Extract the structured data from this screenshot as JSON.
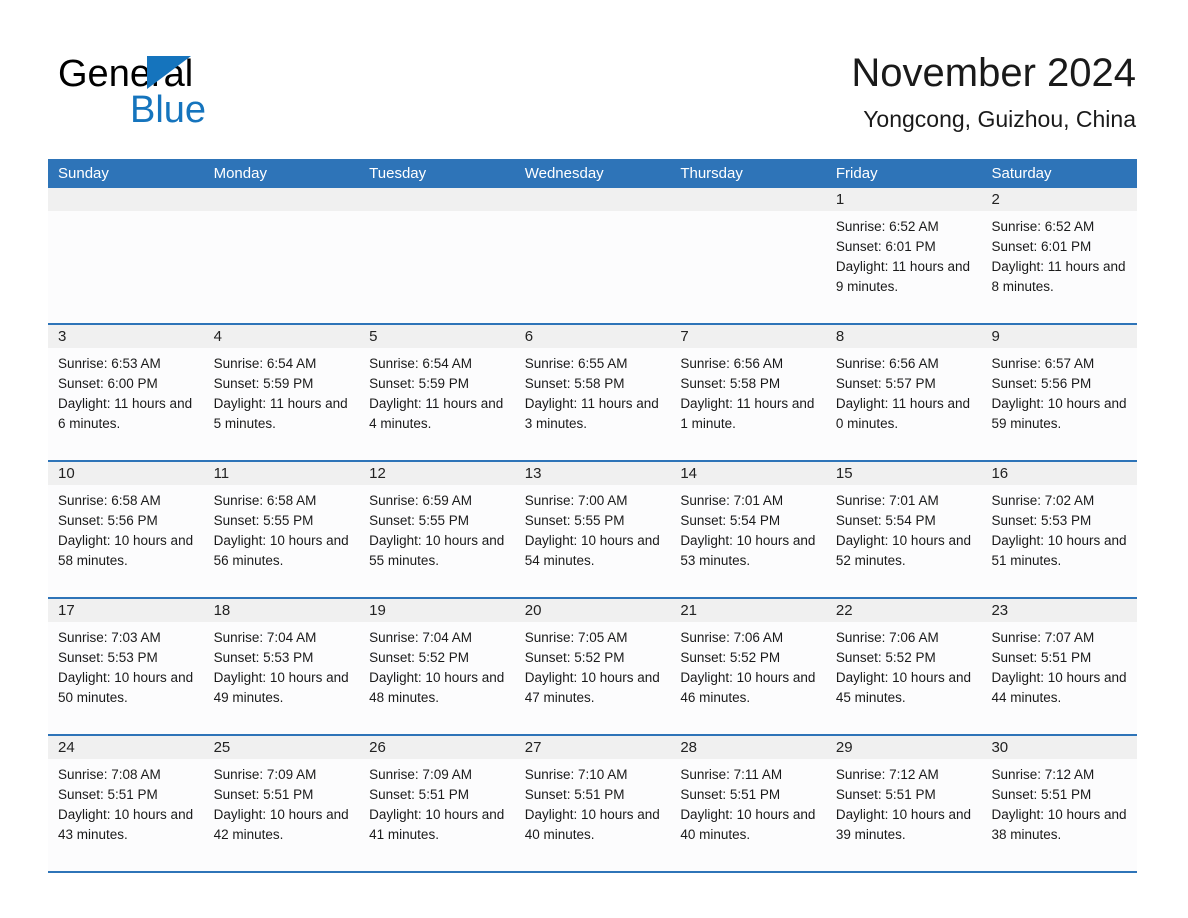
{
  "brand": {
    "name_part1": "General",
    "name_part2": "Blue",
    "accent_color": "#1574bd"
  },
  "header": {
    "title": "November 2024",
    "subtitle": "Yongcong, Guizhou, China"
  },
  "calendar": {
    "header_color": "#2e74b8",
    "daynum_band_color": "#f0f0f0",
    "weekdays": [
      "Sunday",
      "Monday",
      "Tuesday",
      "Wednesday",
      "Thursday",
      "Friday",
      "Saturday"
    ],
    "weeks": [
      [
        {
          "day": "",
          "sunrise": "",
          "sunset": "",
          "daylight": ""
        },
        {
          "day": "",
          "sunrise": "",
          "sunset": "",
          "daylight": ""
        },
        {
          "day": "",
          "sunrise": "",
          "sunset": "",
          "daylight": ""
        },
        {
          "day": "",
          "sunrise": "",
          "sunset": "",
          "daylight": ""
        },
        {
          "day": "",
          "sunrise": "",
          "sunset": "",
          "daylight": ""
        },
        {
          "day": "1",
          "sunrise": "Sunrise: 6:52 AM",
          "sunset": "Sunset: 6:01 PM",
          "daylight": "Daylight: 11 hours and 9 minutes."
        },
        {
          "day": "2",
          "sunrise": "Sunrise: 6:52 AM",
          "sunset": "Sunset: 6:01 PM",
          "daylight": "Daylight: 11 hours and 8 minutes."
        }
      ],
      [
        {
          "day": "3",
          "sunrise": "Sunrise: 6:53 AM",
          "sunset": "Sunset: 6:00 PM",
          "daylight": "Daylight: 11 hours and 6 minutes."
        },
        {
          "day": "4",
          "sunrise": "Sunrise: 6:54 AM",
          "sunset": "Sunset: 5:59 PM",
          "daylight": "Daylight: 11 hours and 5 minutes."
        },
        {
          "day": "5",
          "sunrise": "Sunrise: 6:54 AM",
          "sunset": "Sunset: 5:59 PM",
          "daylight": "Daylight: 11 hours and 4 minutes."
        },
        {
          "day": "6",
          "sunrise": "Sunrise: 6:55 AM",
          "sunset": "Sunset: 5:58 PM",
          "daylight": "Daylight: 11 hours and 3 minutes."
        },
        {
          "day": "7",
          "sunrise": "Sunrise: 6:56 AM",
          "sunset": "Sunset: 5:58 PM",
          "daylight": "Daylight: 11 hours and 1 minute."
        },
        {
          "day": "8",
          "sunrise": "Sunrise: 6:56 AM",
          "sunset": "Sunset: 5:57 PM",
          "daylight": "Daylight: 11 hours and 0 minutes."
        },
        {
          "day": "9",
          "sunrise": "Sunrise: 6:57 AM",
          "sunset": "Sunset: 5:56 PM",
          "daylight": "Daylight: 10 hours and 59 minutes."
        }
      ],
      [
        {
          "day": "10",
          "sunrise": "Sunrise: 6:58 AM",
          "sunset": "Sunset: 5:56 PM",
          "daylight": "Daylight: 10 hours and 58 minutes."
        },
        {
          "day": "11",
          "sunrise": "Sunrise: 6:58 AM",
          "sunset": "Sunset: 5:55 PM",
          "daylight": "Daylight: 10 hours and 56 minutes."
        },
        {
          "day": "12",
          "sunrise": "Sunrise: 6:59 AM",
          "sunset": "Sunset: 5:55 PM",
          "daylight": "Daylight: 10 hours and 55 minutes."
        },
        {
          "day": "13",
          "sunrise": "Sunrise: 7:00 AM",
          "sunset": "Sunset: 5:55 PM",
          "daylight": "Daylight: 10 hours and 54 minutes."
        },
        {
          "day": "14",
          "sunrise": "Sunrise: 7:01 AM",
          "sunset": "Sunset: 5:54 PM",
          "daylight": "Daylight: 10 hours and 53 minutes."
        },
        {
          "day": "15",
          "sunrise": "Sunrise: 7:01 AM",
          "sunset": "Sunset: 5:54 PM",
          "daylight": "Daylight: 10 hours and 52 minutes."
        },
        {
          "day": "16",
          "sunrise": "Sunrise: 7:02 AM",
          "sunset": "Sunset: 5:53 PM",
          "daylight": "Daylight: 10 hours and 51 minutes."
        }
      ],
      [
        {
          "day": "17",
          "sunrise": "Sunrise: 7:03 AM",
          "sunset": "Sunset: 5:53 PM",
          "daylight": "Daylight: 10 hours and 50 minutes."
        },
        {
          "day": "18",
          "sunrise": "Sunrise: 7:04 AM",
          "sunset": "Sunset: 5:53 PM",
          "daylight": "Daylight: 10 hours and 49 minutes."
        },
        {
          "day": "19",
          "sunrise": "Sunrise: 7:04 AM",
          "sunset": "Sunset: 5:52 PM",
          "daylight": "Daylight: 10 hours and 48 minutes."
        },
        {
          "day": "20",
          "sunrise": "Sunrise: 7:05 AM",
          "sunset": "Sunset: 5:52 PM",
          "daylight": "Daylight: 10 hours and 47 minutes."
        },
        {
          "day": "21",
          "sunrise": "Sunrise: 7:06 AM",
          "sunset": "Sunset: 5:52 PM",
          "daylight": "Daylight: 10 hours and 46 minutes."
        },
        {
          "day": "22",
          "sunrise": "Sunrise: 7:06 AM",
          "sunset": "Sunset: 5:52 PM",
          "daylight": "Daylight: 10 hours and 45 minutes."
        },
        {
          "day": "23",
          "sunrise": "Sunrise: 7:07 AM",
          "sunset": "Sunset: 5:51 PM",
          "daylight": "Daylight: 10 hours and 44 minutes."
        }
      ],
      [
        {
          "day": "24",
          "sunrise": "Sunrise: 7:08 AM",
          "sunset": "Sunset: 5:51 PM",
          "daylight": "Daylight: 10 hours and 43 minutes."
        },
        {
          "day": "25",
          "sunrise": "Sunrise: 7:09 AM",
          "sunset": "Sunset: 5:51 PM",
          "daylight": "Daylight: 10 hours and 42 minutes."
        },
        {
          "day": "26",
          "sunrise": "Sunrise: 7:09 AM",
          "sunset": "Sunset: 5:51 PM",
          "daylight": "Daylight: 10 hours and 41 minutes."
        },
        {
          "day": "27",
          "sunrise": "Sunrise: 7:10 AM",
          "sunset": "Sunset: 5:51 PM",
          "daylight": "Daylight: 10 hours and 40 minutes."
        },
        {
          "day": "28",
          "sunrise": "Sunrise: 7:11 AM",
          "sunset": "Sunset: 5:51 PM",
          "daylight": "Daylight: 10 hours and 40 minutes."
        },
        {
          "day": "29",
          "sunrise": "Sunrise: 7:12 AM",
          "sunset": "Sunset: 5:51 PM",
          "daylight": "Daylight: 10 hours and 39 minutes."
        },
        {
          "day": "30",
          "sunrise": "Sunrise: 7:12 AM",
          "sunset": "Sunset: 5:51 PM",
          "daylight": "Daylight: 10 hours and 38 minutes."
        }
      ]
    ]
  }
}
